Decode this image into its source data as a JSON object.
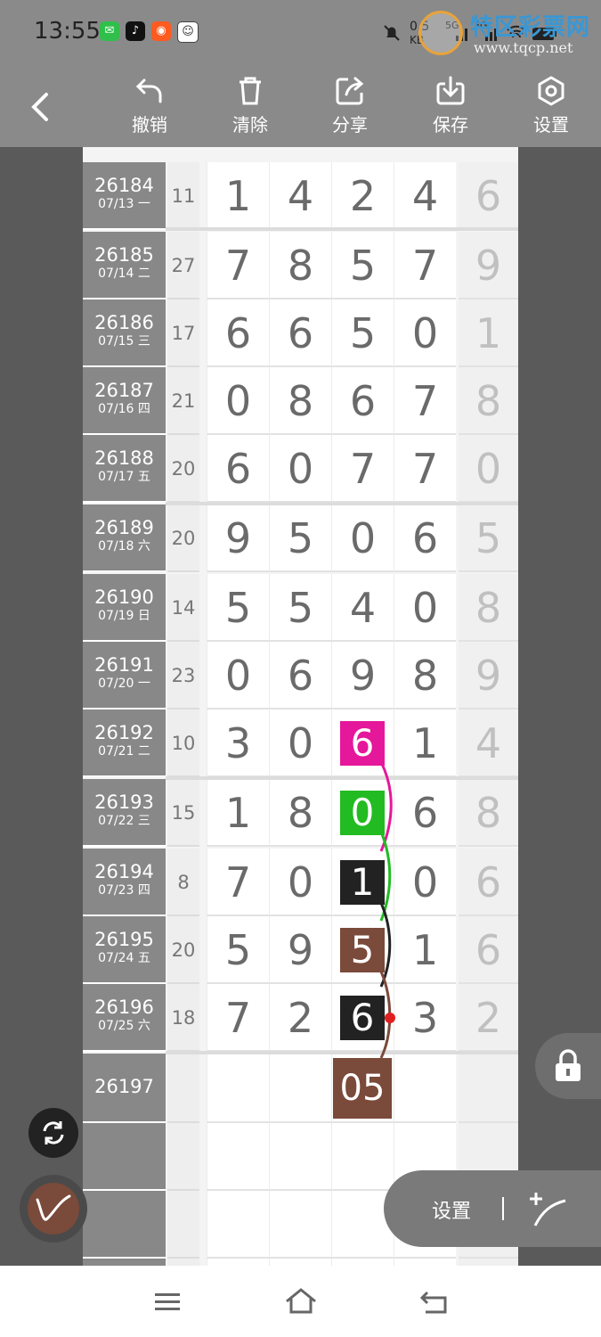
{
  "status": {
    "time": "13:55",
    "net_speed_top": "0.5",
    "net_speed_unit": "KB",
    "cell_label_1": "5G",
    "cell_label_2": "5G",
    "app_icons": [
      "wechat-icon",
      "tiktok-icon",
      "kuaishou-icon",
      "avatar-icon"
    ]
  },
  "watermark": {
    "title": "特区彩票网",
    "url": "www.tqcp.net"
  },
  "toolbar": {
    "back_icon": "back-chevron-icon",
    "items": [
      {
        "label": "撤销",
        "icon": "undo-icon"
      },
      {
        "label": "清除",
        "icon": "trash-icon"
      },
      {
        "label": "分享",
        "icon": "share-icon"
      },
      {
        "label": "保存",
        "icon": "download-icon"
      },
      {
        "label": "设置",
        "icon": "settings-hex-icon"
      }
    ]
  },
  "rows": [
    {
      "period": "26184",
      "date": "07/13 一",
      "sum": "11",
      "digits": [
        "1",
        "4",
        "2",
        "4"
      ],
      "extra": "6"
    },
    {
      "period": "26185",
      "date": "07/14 二",
      "sum": "27",
      "digits": [
        "7",
        "8",
        "5",
        "7"
      ],
      "extra": "9"
    },
    {
      "period": "26186",
      "date": "07/15 三",
      "sum": "17",
      "digits": [
        "6",
        "6",
        "5",
        "0"
      ],
      "extra": "1"
    },
    {
      "period": "26187",
      "date": "07/16 四",
      "sum": "21",
      "digits": [
        "0",
        "8",
        "6",
        "7"
      ],
      "extra": "8"
    },
    {
      "period": "26188",
      "date": "07/17 五",
      "sum": "20",
      "digits": [
        "6",
        "0",
        "7",
        "7"
      ],
      "extra": "0"
    },
    {
      "period": "26189",
      "date": "07/18 六",
      "sum": "20",
      "digits": [
        "9",
        "5",
        "0",
        "6"
      ],
      "extra": "5"
    },
    {
      "period": "26190",
      "date": "07/19 日",
      "sum": "14",
      "digits": [
        "5",
        "5",
        "4",
        "0"
      ],
      "extra": "8"
    },
    {
      "period": "26191",
      "date": "07/20 一",
      "sum": "23",
      "digits": [
        "0",
        "6",
        "9",
        "8"
      ],
      "extra": "9"
    },
    {
      "period": "26192",
      "date": "07/21 二",
      "sum": "10",
      "digits": [
        "3",
        "0",
        "6",
        "1"
      ],
      "extra": "4"
    },
    {
      "period": "26193",
      "date": "07/22 三",
      "sum": "15",
      "digits": [
        "1",
        "8",
        "0",
        "6"
      ],
      "extra": "8"
    },
    {
      "period": "26194",
      "date": "07/23 四",
      "sum": "8",
      "digits": [
        "7",
        "0",
        "1",
        "0"
      ],
      "extra": "6"
    },
    {
      "period": "26195",
      "date": "07/24 五",
      "sum": "20",
      "digits": [
        "5",
        "9",
        "5",
        "1"
      ],
      "extra": "6"
    },
    {
      "period": "26196",
      "date": "07/25 六",
      "sum": "18",
      "digits": [
        "7",
        "2",
        "6",
        "3"
      ],
      "extra": "2"
    }
  ],
  "highlights": [
    {
      "row": 8,
      "col": 2,
      "color": "#e5179a"
    },
    {
      "row": 9,
      "col": 2,
      "color": "#22bb22"
    },
    {
      "row": 10,
      "col": 2,
      "color": "#222222"
    },
    {
      "row": 11,
      "col": 2,
      "color": "#7a4a3a"
    },
    {
      "row": 12,
      "col": 2,
      "color": "#222222"
    }
  ],
  "next_period": {
    "period": "26197",
    "prediction": "05",
    "color": "#7a4a3a"
  },
  "floating": {
    "lock_icon": "lock-icon",
    "refresh_icon": "refresh-icon",
    "pen_icon": "pen-icon",
    "settings_label": "设置",
    "curve_tool_icon": "add-curve-icon"
  },
  "navbar": {
    "icons": [
      "menu-icon",
      "home-icon",
      "back-icon"
    ]
  }
}
